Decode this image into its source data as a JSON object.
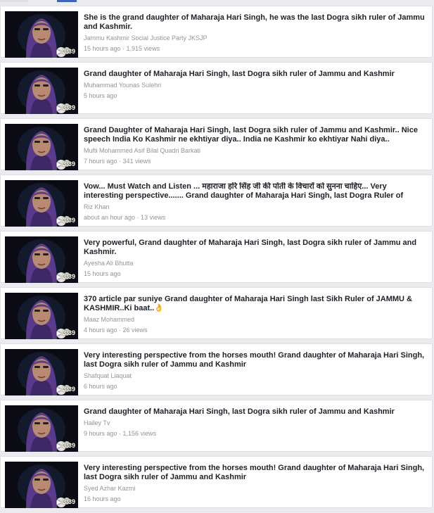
{
  "videos": [
    {
      "title": "She is the grand daughter of Maharaja Hari Singh, he was the last Dogra sikh ruler of Jammu and Kashmir.",
      "author": "Jammu Kashmir Social Justice Party JKSJP",
      "meta": "15 hours ago · 1,915 views",
      "duration": "3:39"
    },
    {
      "title": "Grand daughter of Maharaja Hari Singh, last Dogra sikh ruler of Jammu and Kashmir",
      "author": "Muhammad Younas Sulehri",
      "meta": "5 hours ago",
      "duration": "3:39"
    },
    {
      "title": "Grand Daughter of Maharaja Hari Singh, last Dogra sikh ruler of Jammu and Kashmir.. Nice speech India Ko Kashmir ne ekhtiyar diya.. India ne Kashmir ko ekhtiyar Nahi diya..",
      "author": "Mufti Mohammed Asif Bilal Quadri Barkati",
      "meta": "7 hours ago · 341 views",
      "duration": "3:39"
    },
    {
      "title": "Vow... Must Watch and Listen ... महाराजा हरि सिंह जी की पोती के विचारों को सुनना चाहिए... Very interesting perspective....... Grand daughter of Maharaja Hari Singh, last Dogra Ruler of Jammu…",
      "author": "Riz Khan",
      "meta": "about an hour ago · 13 views",
      "duration": "3:39"
    },
    {
      "title": "Very powerful, Grand daughter of Maharaja Hari Singh, last Dogra sikh ruler of Jammu and Kashmir.",
      "author": "Ayesha Ali Bhutta",
      "meta": "15 hours ago",
      "duration": "3:39"
    },
    {
      "title": "370 article par suniye Grand daughter of Maharaja Hari Singh last Sikh Ruler of JAMMU & KASHMIR..Ki baat..👌",
      "author": "Maaz Mohammed",
      "meta": "4 hours ago · 26 views",
      "duration": "3:39"
    },
    {
      "title": "Very interesting perspective from the horses mouth! Grand daughter of Maharaja Hari Singh, last Dogra sikh ruler of Jammu and Kashmir",
      "author": "Shafquat Liaquat",
      "meta": "6 hours ago",
      "duration": "3:39"
    },
    {
      "title": "Grand daughter of Maharaja Hari Singh, last Dogra sikh ruler of Jammu and Kashmir",
      "author": "Hailey Tv",
      "meta": "9 hours ago · 1,156 views",
      "duration": "3:39"
    },
    {
      "title": "Very interesting perspective from the horses mouth! Grand daughter of Maharaja Hari Singh, last Dogra sikh ruler of Jammu and Kashmir",
      "author": "Syed Azhar Kazmi",
      "meta": "16 hours ago",
      "duration": "3:39"
    }
  ],
  "colors": {
    "page_bg": "#e9ebee",
    "card_bg": "#ffffff",
    "title": "#1d2129",
    "secondary": "#90949c",
    "accent": "#4267b2",
    "thumb_bg": "#0b0b14",
    "scarf": "#5b3a8c",
    "skin": "#b98a72"
  }
}
